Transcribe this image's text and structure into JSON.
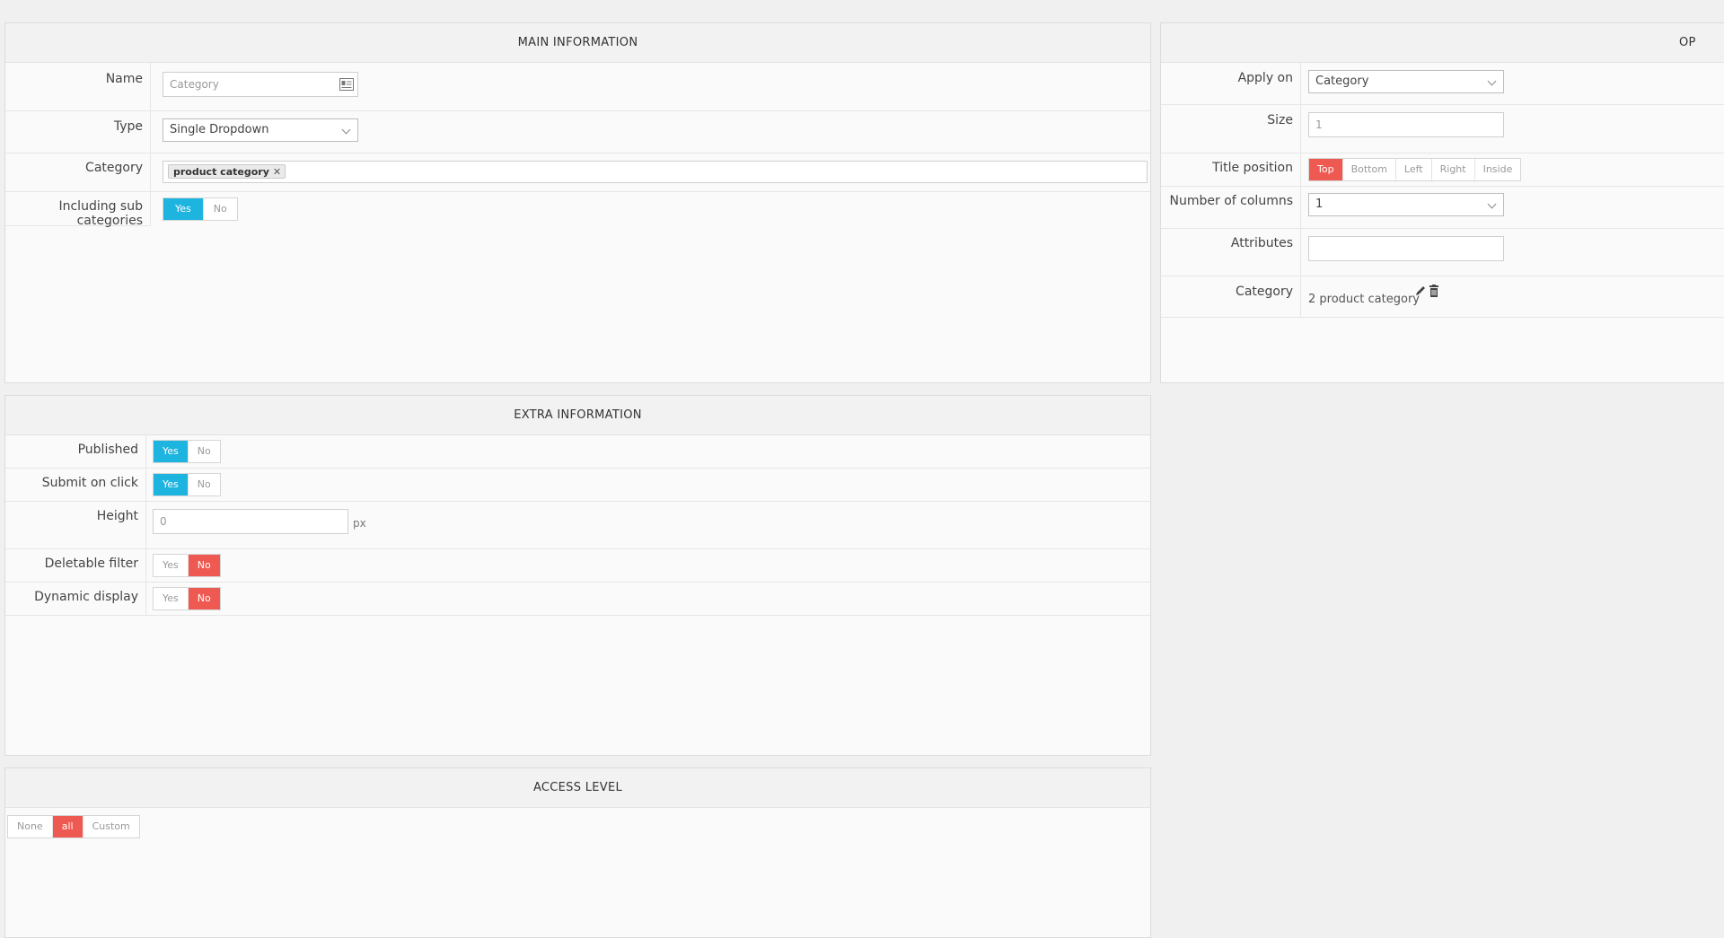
{
  "main": {
    "title": "MAIN INFORMATION",
    "name_label": "Name",
    "name_placeholder": "Category",
    "type_label": "Type",
    "type_value": "Single Dropdown",
    "category_label": "Category",
    "category_tag": "product category",
    "sub_label": "Including sub categories",
    "yes": "Yes",
    "no": "No"
  },
  "options": {
    "title": "OP",
    "apply_label": "Apply on",
    "apply_value": "Category",
    "size_label": "Size",
    "size_placeholder": "1",
    "title_pos_label": "Title position",
    "title_pos_options": [
      "Top",
      "Bottom",
      "Left",
      "Right",
      "Inside"
    ],
    "cols_label": "Number of columns",
    "cols_value": "1",
    "attributes_label": "Attributes",
    "category_label": "Category",
    "category_value": "2 product category"
  },
  "extra": {
    "title": "EXTRA INFORMATION",
    "published_label": "Published",
    "submit_label": "Submit on click",
    "height_label": "Height",
    "height_placeholder": "0",
    "height_unit": "px",
    "deletable_label": "Deletable filter",
    "dynamic_label": "Dynamic display",
    "yes": "Yes",
    "no": "No"
  },
  "access": {
    "title": "ACCESS LEVEL",
    "options": [
      "None",
      "all",
      "Custom"
    ]
  },
  "colors": {
    "blue": "#1eb4e0",
    "red": "#ee5a52"
  }
}
